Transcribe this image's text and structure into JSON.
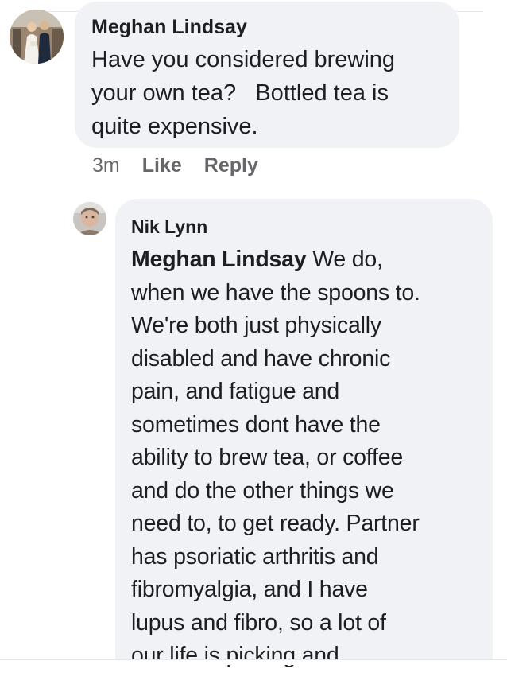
{
  "comments": [
    {
      "author": "Meghan Lindsay",
      "lines": [
        "Have you considered brewing",
        "your own tea?   Bottled tea is",
        "quite expensive."
      ],
      "time": "3m",
      "like_label": "Like",
      "reply_label": "Reply"
    },
    {
      "author": "Nik Lynn",
      "mention": "Meghan Lindsay",
      "first_line_rest": " We do,",
      "lines": [
        "when we have the spoons to.",
        "We're both just physically",
        "disabled and have chronic",
        "pain, and fatigue and",
        "sometimes dont have the",
        "ability to brew tea, or coffee",
        "and do the other things we",
        "need to, to get ready. Partner",
        "has psoriatic arthritis and",
        "fibromyalgia, and I have",
        "lupus and fibro, so a lot of",
        "our life is picking and"
      ]
    }
  ],
  "colors": {
    "bubble_bg": "#f0f2f5",
    "text": "#1c1e21",
    "secondary_text": "#65676b"
  }
}
